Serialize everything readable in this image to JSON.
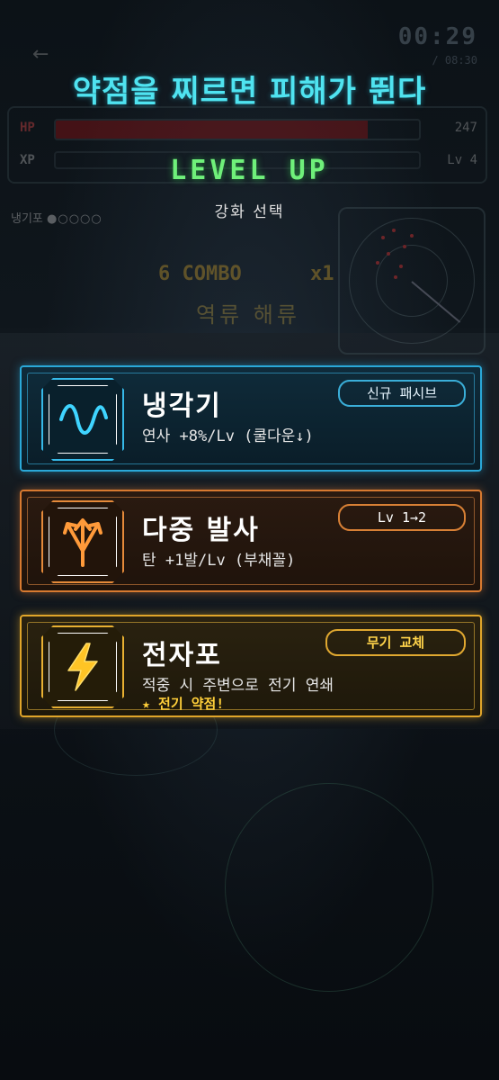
{
  "banner": "약점을 찌르면 피해가 뛴다",
  "levelup": {
    "title": "LEVEL UP",
    "subtitle": "강화 선택"
  },
  "hud": {
    "timer": "00:29",
    "timer_sub": "/ 08:30",
    "hp_label": "HP",
    "hp_value": "247",
    "hp_fill": 0.86,
    "xp_label": "XP",
    "level_value": "Lv 4",
    "weapon_name": "냉기포",
    "weapon_pips": "●○○○○",
    "combo": "6 COMBO",
    "combo_mult": "x1",
    "current_effect": "역류 해류"
  },
  "cards": [
    {
      "title": "냉각기",
      "desc": "연사 +8%/Lv (쿨다운↓)",
      "badge": "신규 패시브",
      "icon": "wave-icon",
      "color": "#2aa8d8"
    },
    {
      "title": "다중 발사",
      "desc": "탄 +1발/Lv (부채꼴)",
      "badge": "Lv 1→2",
      "icon": "trident-arrows-icon",
      "color": "#d87a30"
    },
    {
      "title": "전자포",
      "desc": "적중 시 주변으로 전기 연쇄",
      "extra": "★ 전기  약점!",
      "badge": "무기 교체",
      "icon": "lightning-icon",
      "color": "#e0a52a"
    }
  ]
}
